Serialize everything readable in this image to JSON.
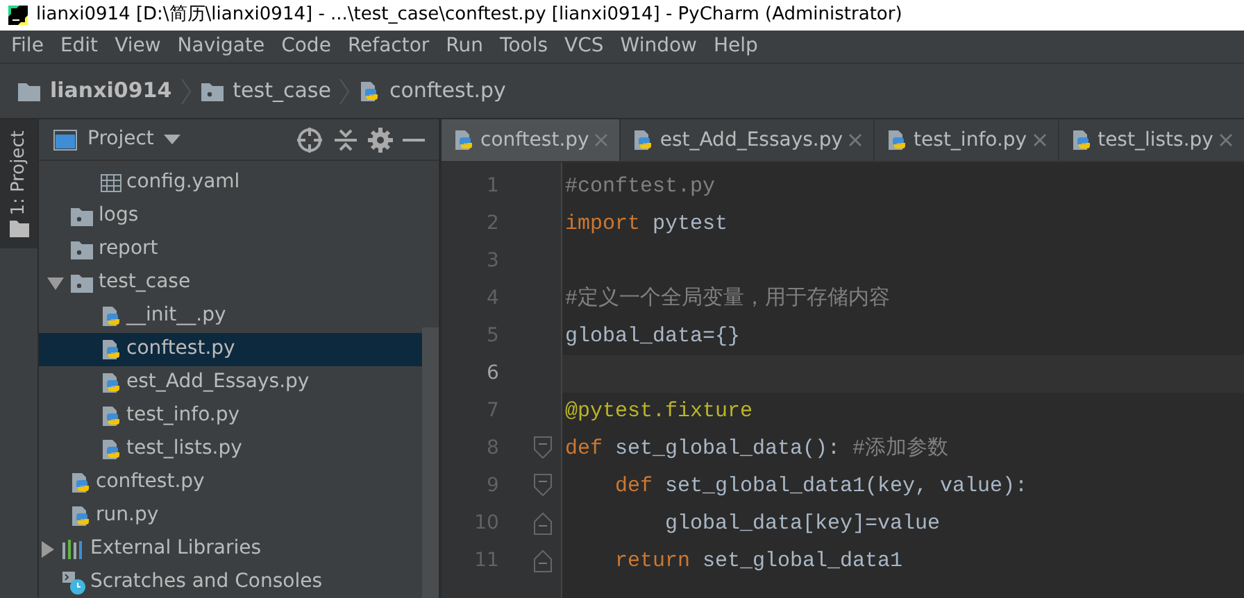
{
  "window": {
    "title": "lianxi0914 [D:\\简历\\lianxi0914] - ...\\test_case\\conftest.py [lianxi0914] - PyCharm (Administrator)"
  },
  "menu": [
    "File",
    "Edit",
    "View",
    "Navigate",
    "Code",
    "Refactor",
    "Run",
    "Tools",
    "VCS",
    "Window",
    "Help"
  ],
  "breadcrumb": [
    {
      "label": "lianxi0914",
      "kind": "folder"
    },
    {
      "label": "test_case",
      "kind": "package"
    },
    {
      "label": "conftest.py",
      "kind": "python"
    }
  ],
  "tool_stripe": {
    "label": "1: Project",
    "selected": true
  },
  "project_panel": {
    "title": "Project",
    "tree": [
      {
        "children": [
          {
            "children": [
              {
                "label": "config.yaml",
                "kind": "yaml",
                "selected": false
              }
            ]
          },
          {
            "label": "logs",
            "kind": "package",
            "selected": false
          },
          {
            "label": "report",
            "kind": "package",
            "selected": false
          },
          {
            "label": "test_case",
            "kind": "package",
            "expanded": true,
            "selected": false,
            "children": [
              {
                "label": "__init__.py",
                "kind": "python",
                "selected": false
              },
              {
                "label": "conftest.py",
                "kind": "python",
                "selected": true
              },
              {
                "label": "est_Add_Essays.py",
                "kind": "python",
                "selected": false
              },
              {
                "label": "test_info.py",
                "kind": "python",
                "selected": false
              },
              {
                "label": "test_lists.py",
                "kind": "python",
                "selected": false
              }
            ]
          },
          {
            "label": "conftest.py",
            "kind": "python",
            "selected": false
          },
          {
            "label": "run.py",
            "kind": "python",
            "selected": false
          }
        ]
      },
      {
        "label": "External Libraries",
        "kind": "libraries",
        "expanded": false,
        "selected": false
      },
      {
        "label": "Scratches and Consoles",
        "kind": "scratches",
        "selected": false
      }
    ]
  },
  "tabs": [
    {
      "label": "conftest.py",
      "selected": true
    },
    {
      "label": "est_Add_Essays.py",
      "selected": false
    },
    {
      "label": "test_info.py",
      "selected": false
    },
    {
      "label": "test_lists.py",
      "selected": false
    }
  ],
  "editor": {
    "lines": [
      {
        "number": "1",
        "current": false,
        "tokens": [
          {
            "kind": "comment",
            "text": "#conftest.py"
          }
        ]
      },
      {
        "number": "2",
        "current": false,
        "tokens": [
          {
            "kind": "keyword",
            "text": "import"
          },
          {
            "kind": "plain",
            "text": " pytest"
          }
        ]
      },
      {
        "number": "3",
        "current": false
      },
      {
        "number": "4",
        "current": false,
        "tokens": [
          {
            "kind": "comment",
            "text": "#定义一个全局变量，用于存储内容"
          }
        ]
      },
      {
        "number": "5",
        "current": false,
        "tokens": [
          {
            "kind": "plain",
            "text": "global_data={}"
          }
        ]
      },
      {
        "number": "6",
        "current": true
      },
      {
        "number": "7",
        "current": false,
        "tokens": [
          {
            "kind": "decorator",
            "text": "@pytest.fixture"
          }
        ]
      },
      {
        "number": "8",
        "current": false,
        "fold_start": true,
        "tokens": [
          {
            "kind": "keyword",
            "text": "def"
          },
          {
            "kind": "plain",
            "text": " set_global_data(): "
          },
          {
            "kind": "comment",
            "text": "#添加参数"
          }
        ]
      },
      {
        "number": "9",
        "current": false,
        "fold_start": true,
        "tokens": [
          {
            "kind": "keyword",
            "text": "    def"
          },
          {
            "kind": "plain",
            "text": " set_global_data1(key, value):"
          }
        ]
      },
      {
        "number": "10",
        "current": false,
        "fold_end": true,
        "tokens": [
          {
            "kind": "plain",
            "text": "        global_data[key]=value"
          }
        ]
      },
      {
        "number": "11",
        "current": false,
        "fold_end": true,
        "tokens": [
          {
            "kind": "keyword",
            "text": "    return"
          },
          {
            "kind": "plain",
            "text": " set_global_data1"
          }
        ]
      }
    ]
  }
}
